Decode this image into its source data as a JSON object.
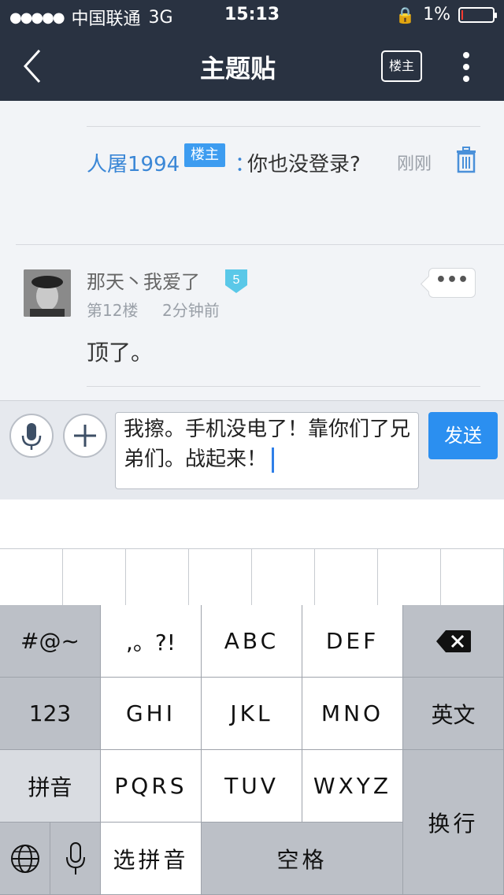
{
  "status_bar": {
    "carrier": "中国联通",
    "network": "3G",
    "time": "15:13",
    "battery_percent": "1%",
    "battery_level": 0.03
  },
  "nav": {
    "title": "主题贴",
    "louzhu_label": "楼主"
  },
  "reply": {
    "user": "人屠1994",
    "badge": "楼主",
    "colon": "：",
    "text": "你也没登录?",
    "time": "刚刚"
  },
  "post": {
    "user": "那天丶我爱了",
    "level": "5",
    "floor": "第12楼",
    "time": "2分钟前",
    "text": "顶了。",
    "more_label": "•••"
  },
  "composer": {
    "text": "我擦。手机没电了！靠你们了兄弟们。战起来！",
    "send_label": "发送"
  },
  "keyboard": {
    "row1": [
      "#@~",
      ",。?!",
      "ABC",
      "DEF"
    ],
    "row2": [
      "123",
      "GHI",
      "JKL",
      "MNO",
      "英文"
    ],
    "row3": [
      "拼音",
      "PQRS",
      "TUV",
      "WXYZ"
    ],
    "row4": [
      "选拼音",
      "空格"
    ],
    "enter": "换行"
  }
}
